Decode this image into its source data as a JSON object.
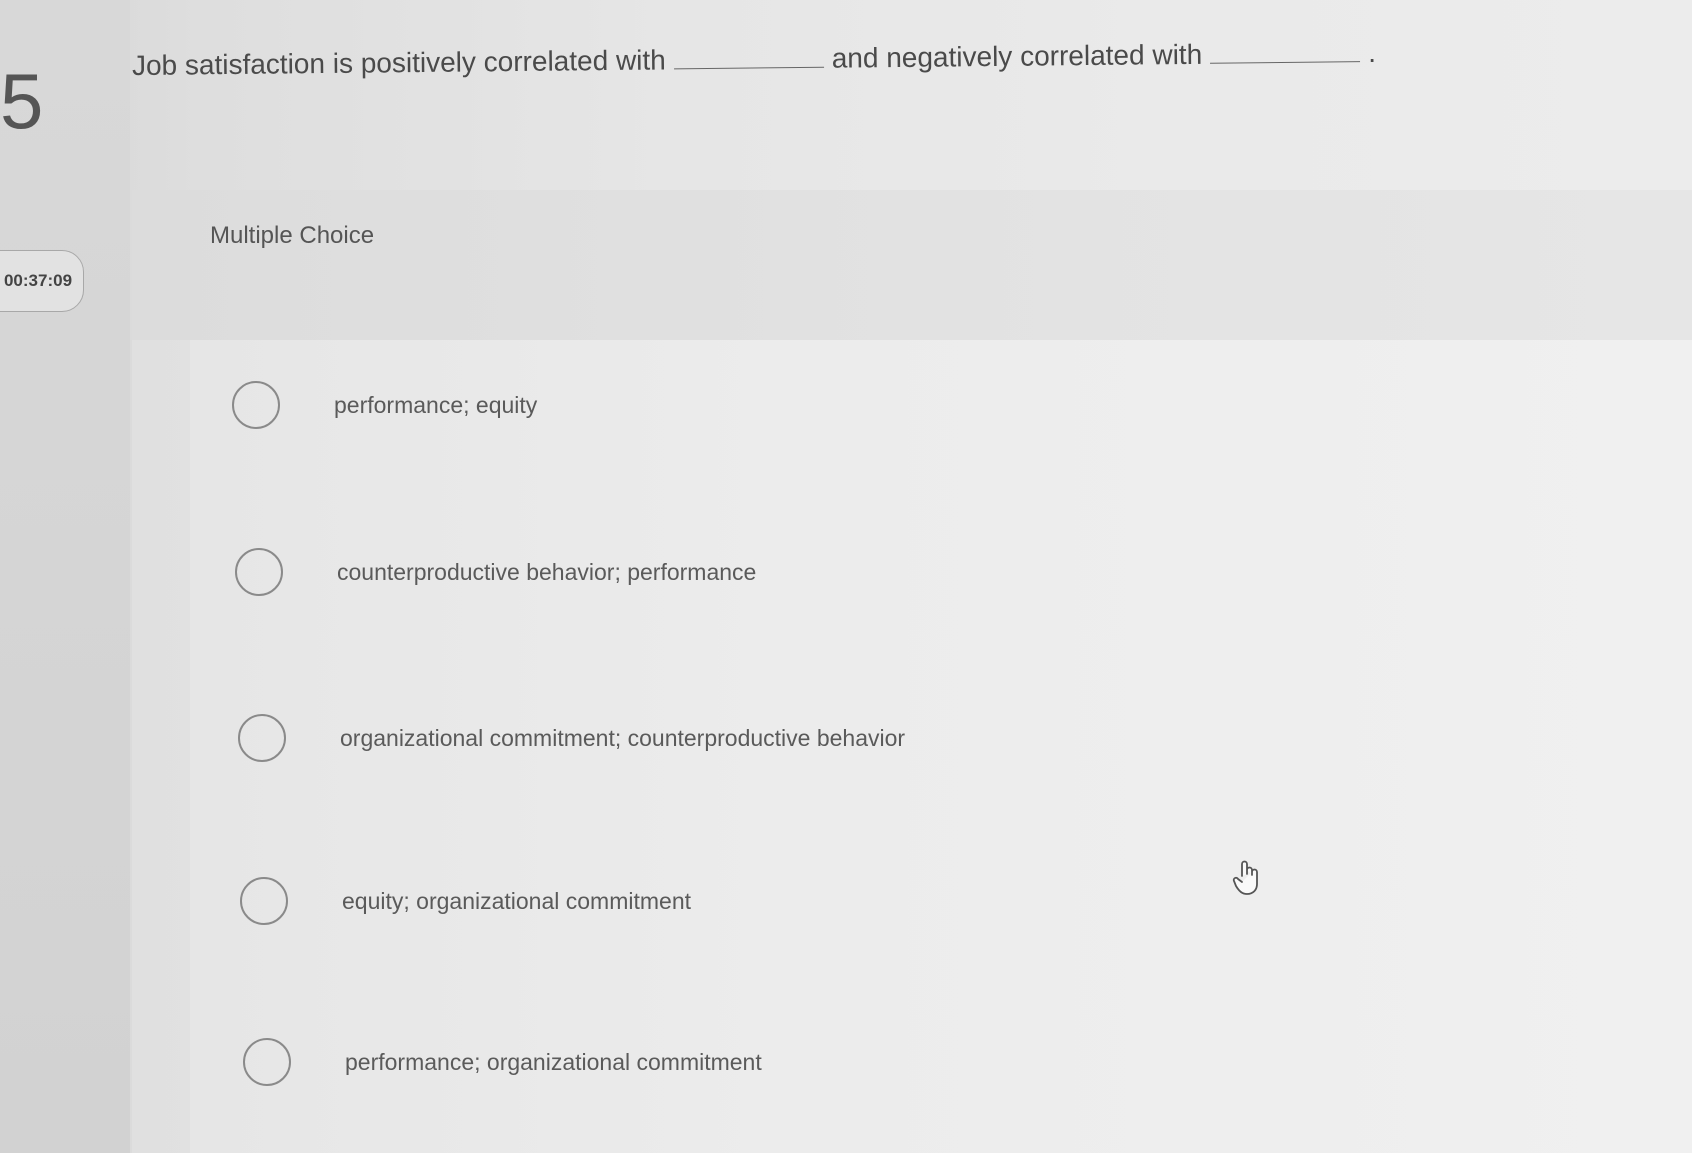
{
  "question": {
    "number": "5",
    "text_part1": "Job satisfaction is positively correlated with",
    "text_part2": "and negatively correlated with",
    "text_end": "."
  },
  "timer": {
    "value": "00:37:09"
  },
  "panel": {
    "type_label": "Multiple Choice"
  },
  "choices": [
    {
      "label": "performance; equity",
      "selected": false
    },
    {
      "label": "counterproductive behavior; performance",
      "selected": false
    },
    {
      "label": "organizational commitment; counterproductive behavior",
      "selected": false
    },
    {
      "label": "equity; organizational commitment",
      "selected": false
    },
    {
      "label": "performance; organizational commitment",
      "selected": false
    }
  ],
  "icons": {
    "cursor": "hand-pointer-icon",
    "radio": "radio-circle-icon"
  }
}
